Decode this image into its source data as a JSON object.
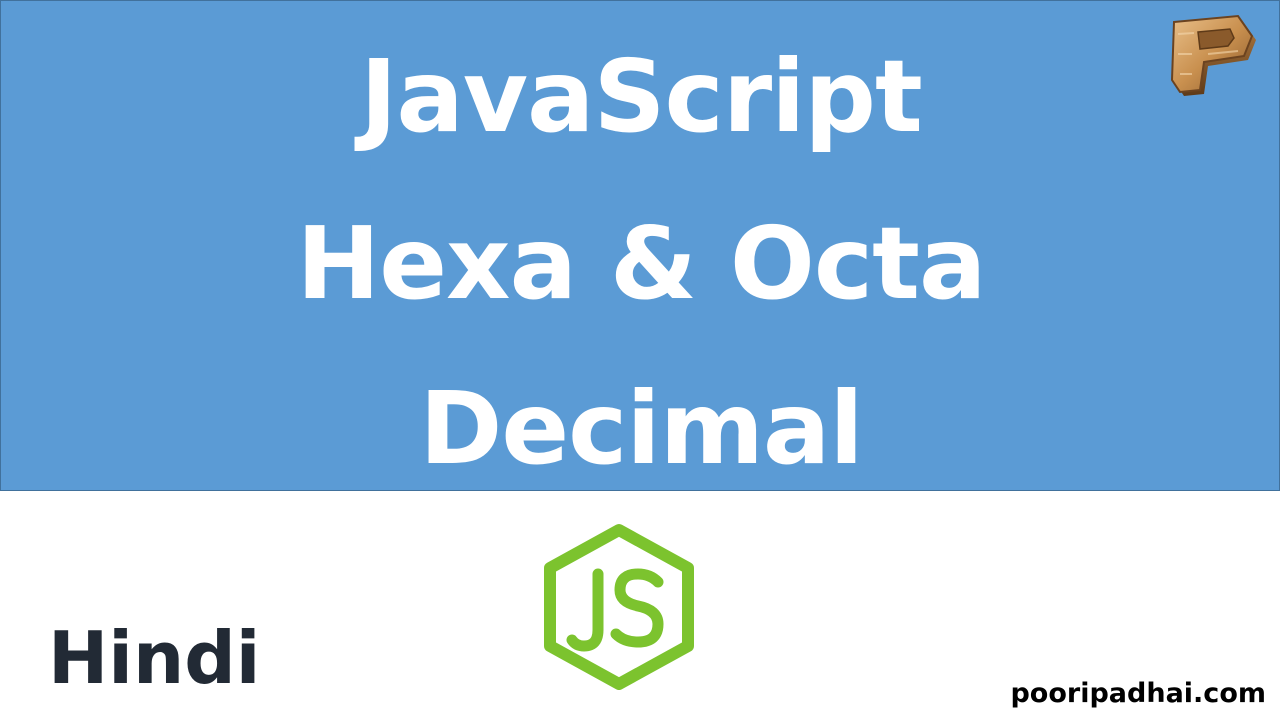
{
  "title": {
    "line1": "JavaScript",
    "line2": "Hexa & Octa",
    "line3": "Decimal"
  },
  "language_label": "Hindi",
  "website": "pooripadhai.com",
  "icons": {
    "brand_logo": "wooden-p-logo-icon",
    "js_logo": "nodejs-hexagon-js-icon"
  },
  "colors": {
    "banner_background": "#5b9bd5",
    "title_text": "#ffffff",
    "js_logo_green": "#7cc32e",
    "language_text": "#222a35",
    "website_text": "#000000"
  }
}
